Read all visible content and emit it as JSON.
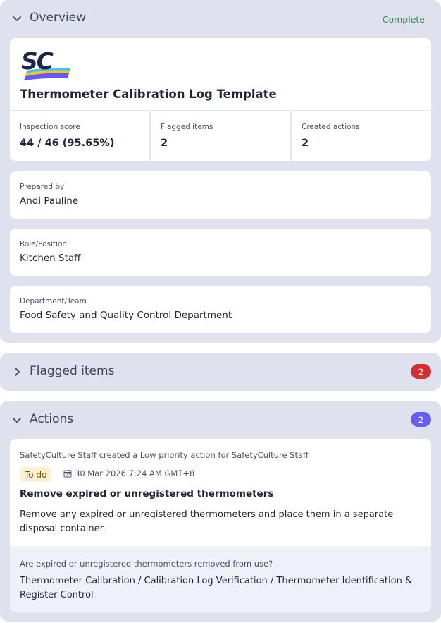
{
  "overview": {
    "title": "Overview",
    "status": "Complete",
    "status_color": "#2f8a4f",
    "logo_text": "SC",
    "document_title": "Thermometer Calibration Log Template",
    "stats": [
      {
        "label": "Inspection score",
        "value": "44 / 46 (95.65%)"
      },
      {
        "label": "Flagged items",
        "value": "2"
      },
      {
        "label": "Created actions",
        "value": "2"
      }
    ],
    "fields": [
      {
        "label": "Prepared by",
        "value": "Andi Pauline"
      },
      {
        "label": "Role/Position",
        "value": "Kitchen Staff"
      },
      {
        "label": "Department/Team",
        "value": "Food Safety and Quality Control Department"
      }
    ]
  },
  "flagged": {
    "title": "Flagged items",
    "count": "2",
    "badge_color": "#d12f36"
  },
  "actions": {
    "title": "Actions",
    "count": "2",
    "badge_color": "#675df0",
    "items": [
      {
        "meta": "SafetyCulture Staff created a Low priority action for SafetyCulture Staff",
        "status": "To do",
        "due": "30 Mar 2026 7:24 AM GMT+8",
        "title": "Remove expired or unregistered thermometers",
        "description": "Remove any expired or unregistered thermometers and place them in a separate disposal container.",
        "question": "Are expired or unregistered thermometers removed from use?",
        "path": "Thermometer Calibration / Calibration Log Verification / Thermometer Identification & Register Control"
      }
    ]
  },
  "icons": {
    "expanded": "chevron-down-icon",
    "collapsed": "chevron-right-icon",
    "due_date": "calendar-icon"
  }
}
